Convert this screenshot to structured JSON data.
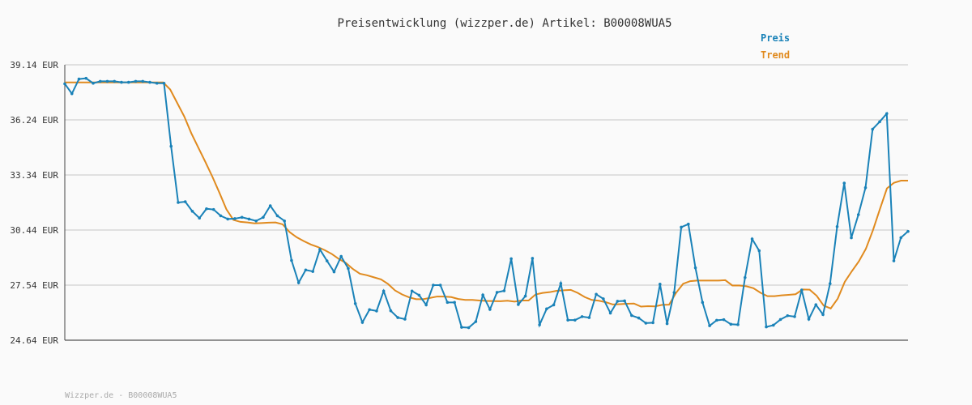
{
  "chart_data": {
    "type": "line",
    "title": "Preisentwicklung (wizzper.de) Artikel: B00008WUA5",
    "footer": "Wizzper.de - B00008WUA5",
    "ylim": [
      24.64,
      39.14
    ],
    "y_ticks": [
      "39.14 EUR",
      "36.24 EUR",
      "33.34 EUR",
      "30.44 EUR",
      "27.54 EUR",
      "24.64 EUR"
    ],
    "y_tick_values": [
      39.14,
      36.24,
      33.34,
      30.44,
      27.54,
      24.64
    ],
    "grid": true,
    "legend_position": "top-right",
    "colors": {
      "Preis": "#1a82b8",
      "Trend": "#e08a1e",
      "grid": "#e0e0e0",
      "axis": "#444444",
      "text": "#333333",
      "footer": "#aaaaaa",
      "background": "#fafafa"
    },
    "series": [
      {
        "name": "Preis",
        "values": [
          38.14,
          37.62,
          38.39,
          38.43,
          38.17,
          38.27,
          38.27,
          38.27,
          38.22,
          38.22,
          38.27,
          38.27,
          38.22,
          38.17,
          38.17,
          34.85,
          31.89,
          31.93,
          31.43,
          31.07,
          31.56,
          31.52,
          31.19,
          31.02,
          31.04,
          31.11,
          31.02,
          30.92,
          31.11,
          31.72,
          31.19,
          30.92,
          28.84,
          27.67,
          28.34,
          28.26,
          29.42,
          28.82,
          28.24,
          29.05,
          28.42,
          26.57,
          25.58,
          26.25,
          26.18,
          27.23,
          26.19,
          25.83,
          25.75,
          27.23,
          27.01,
          26.5,
          27.54,
          27.54,
          26.63,
          26.63,
          25.32,
          25.3,
          25.62,
          27.02,
          26.26,
          27.16,
          27.24,
          28.93,
          26.52,
          26.96,
          28.95,
          25.45,
          26.29,
          26.5,
          27.63,
          25.7,
          25.7,
          25.88,
          25.83,
          27.06,
          26.82,
          26.07,
          26.69,
          26.71,
          25.94,
          25.81,
          25.54,
          25.56,
          27.59,
          25.51,
          27.15,
          30.59,
          30.75,
          28.45,
          26.63,
          25.4,
          25.69,
          25.72,
          25.48,
          25.46,
          27.94,
          29.97,
          29.35,
          25.34,
          25.43,
          25.73,
          25.93,
          25.88,
          27.28,
          25.75,
          26.51,
          25.99,
          27.62,
          30.62,
          32.91,
          30.03,
          31.25,
          32.67,
          35.75,
          36.14,
          36.57,
          28.82,
          30.04,
          30.37
        ]
      },
      {
        "name": "Trend",
        "values": [
          38.21,
          38.21,
          38.21,
          38.21,
          38.21,
          38.21,
          38.21,
          38.21,
          38.21,
          38.21,
          38.21,
          38.21,
          38.21,
          38.21,
          38.21,
          37.84,
          37.13,
          36.42,
          35.54,
          34.78,
          34.03,
          33.25,
          32.41,
          31.53,
          30.97,
          30.87,
          30.84,
          30.79,
          30.81,
          30.83,
          30.84,
          30.74,
          30.33,
          30.06,
          29.86,
          29.68,
          29.55,
          29.38,
          29.18,
          28.92,
          28.71,
          28.39,
          28.14,
          28.06,
          27.95,
          27.84,
          27.6,
          27.26,
          27.05,
          26.9,
          26.8,
          26.8,
          26.87,
          26.94,
          26.94,
          26.91,
          26.81,
          26.76,
          26.76,
          26.73,
          26.71,
          26.7,
          26.69,
          26.72,
          26.67,
          26.73,
          26.73,
          27.05,
          27.13,
          27.17,
          27.24,
          27.27,
          27.29,
          27.13,
          26.91,
          26.76,
          26.72,
          26.64,
          26.52,
          26.54,
          26.56,
          26.57,
          26.41,
          26.43,
          26.42,
          26.5,
          26.51,
          27.14,
          27.61,
          27.75,
          27.78,
          27.78,
          27.78,
          27.78,
          27.8,
          27.52,
          27.52,
          27.48,
          27.38,
          27.14,
          26.96,
          26.96,
          27.0,
          27.03,
          27.06,
          27.31,
          27.3,
          26.98,
          26.46,
          26.31,
          26.83,
          27.71,
          28.27,
          28.79,
          29.45,
          30.42,
          31.54,
          32.63,
          32.93,
          33.04,
          33.04
        ]
      }
    ]
  }
}
